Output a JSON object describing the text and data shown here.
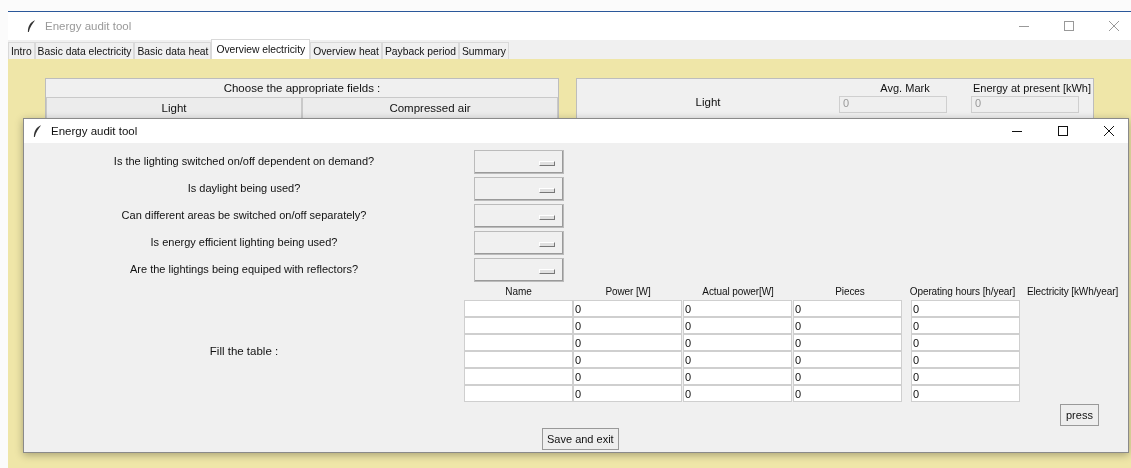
{
  "back_window": {
    "title": "Energy audit tool",
    "tabs": [
      {
        "label": "Intro",
        "selected": false
      },
      {
        "label": "Basic data electricity",
        "selected": false
      },
      {
        "label": "Basic data heat",
        "selected": false
      },
      {
        "label": "Overview electricity",
        "selected": true
      },
      {
        "label": "Overview heat",
        "selected": false
      },
      {
        "label": "Payback period",
        "selected": false
      },
      {
        "label": "Summary",
        "selected": false
      }
    ],
    "left_panel": {
      "heading": "Choose the appropriate fields :",
      "buttons": [
        "Light",
        "Compressed air"
      ]
    },
    "right_panel": {
      "columns": [
        "Avg. Mark",
        "Energy at present [kWh]"
      ],
      "rows": [
        {
          "label": "Light",
          "values": [
            "0",
            "0"
          ]
        }
      ]
    }
  },
  "dialog": {
    "title": "Energy audit tool",
    "questions": [
      "Is the lighting switched on/off dependent on demand?",
      "Is daylight being used?",
      "Can different areas be switched on/off separately?",
      "Is energy efficient lighting being used?",
      "Are the lightings being equiped with reflectors?"
    ],
    "table": {
      "label": "Fill the table :",
      "columns": [
        "Name",
        "Power [W]",
        "Actual power[W]",
        "Pieces",
        "Operating hours [h/year]",
        "Electricity [kWh/year]"
      ],
      "rows": [
        [
          "",
          "0",
          "0",
          "0",
          "0"
        ],
        [
          "",
          "0",
          "0",
          "0",
          "0"
        ],
        [
          "",
          "0",
          "0",
          "0",
          "0"
        ],
        [
          "",
          "0",
          "0",
          "0",
          "0"
        ],
        [
          "",
          "0",
          "0",
          "0",
          "0"
        ],
        [
          "",
          "0",
          "0",
          "0",
          "0"
        ]
      ]
    },
    "press_button": "press",
    "save_button": "Save and exit"
  }
}
